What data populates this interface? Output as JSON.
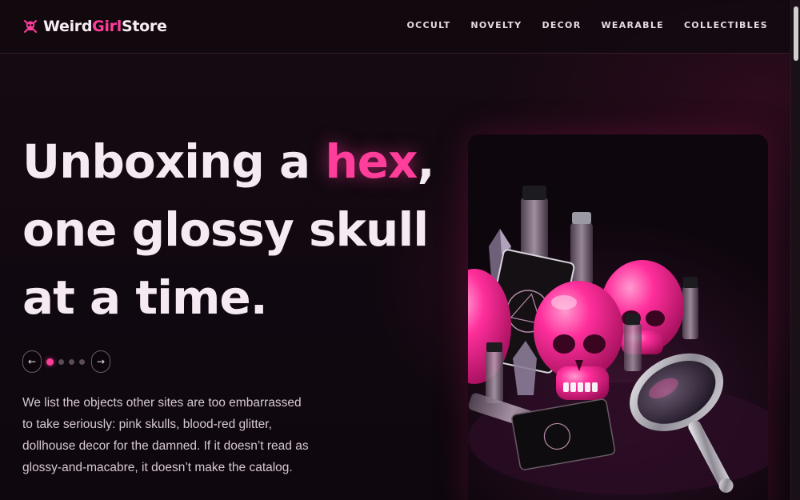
{
  "brand": {
    "name_part1": "Weird",
    "name_accent": "Girl",
    "name_part2": "Store",
    "icon": "skull-crossbones-icon",
    "accent_color": "#ff3d9a"
  },
  "nav": {
    "items": [
      {
        "label": "OCCULT"
      },
      {
        "label": "NOVELTY"
      },
      {
        "label": "DECOR"
      },
      {
        "label": "WEARABLE"
      },
      {
        "label": "COLLECTIBLES"
      }
    ]
  },
  "hero": {
    "headline_before": "Unboxing a ",
    "headline_highlight": "hex",
    "headline_after": ", one glossy skull at a time.",
    "carousel": {
      "prev_label": "←",
      "next_label": "→",
      "slide_count": 4,
      "active_slide": 1
    },
    "blurb": "We list the objects other sites are too embarrassed to take seriously: pink skulls, blood-red glitter, dollhouse decor for the damned. If it doesn’t read as glossy-and-macabre, it doesn’t make the catalog.",
    "image": "pink-skulls-tarot-mirror-vials"
  }
}
